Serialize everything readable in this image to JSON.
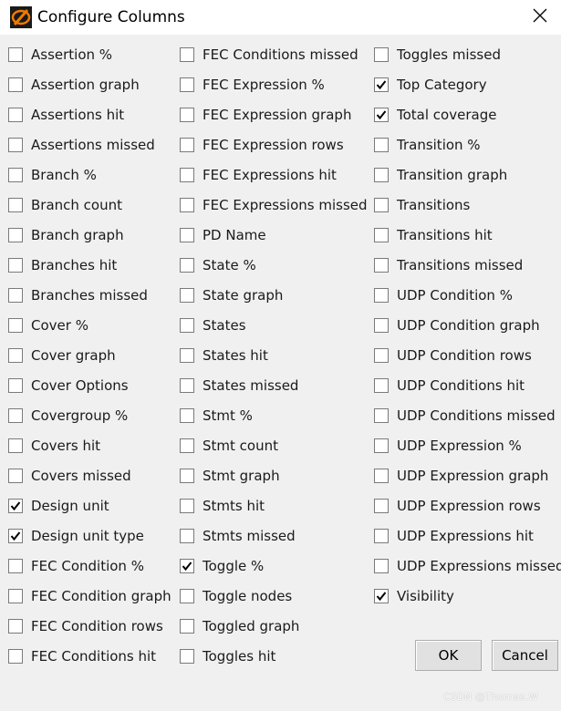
{
  "dialog": {
    "title": "Configure Columns",
    "icon": "app-logo-icon",
    "close_icon": "close-icon"
  },
  "columns": [
    [
      {
        "label": "Assertion %",
        "checked": false
      },
      {
        "label": "Assertion graph",
        "checked": false
      },
      {
        "label": "Assertions hit",
        "checked": false
      },
      {
        "label": "Assertions missed",
        "checked": false
      },
      {
        "label": "Branch %",
        "checked": false
      },
      {
        "label": "Branch count",
        "checked": false
      },
      {
        "label": "Branch graph",
        "checked": false
      },
      {
        "label": "Branches hit",
        "checked": false
      },
      {
        "label": "Branches missed",
        "checked": false
      },
      {
        "label": "Cover %",
        "checked": false
      },
      {
        "label": "Cover graph",
        "checked": false
      },
      {
        "label": "Cover Options",
        "checked": false
      },
      {
        "label": "Covergroup %",
        "checked": false
      },
      {
        "label": "Covers hit",
        "checked": false
      },
      {
        "label": "Covers missed",
        "checked": false
      },
      {
        "label": "Design unit",
        "checked": true
      },
      {
        "label": "Design unit type",
        "checked": true
      },
      {
        "label": "FEC Condition %",
        "checked": false
      },
      {
        "label": "FEC Condition graph",
        "checked": false
      },
      {
        "label": "FEC Condition rows",
        "checked": false
      },
      {
        "label": "FEC Conditions hit",
        "checked": false
      }
    ],
    [
      {
        "label": "FEC Conditions missed",
        "checked": false
      },
      {
        "label": "FEC Expression %",
        "checked": false
      },
      {
        "label": "FEC Expression graph",
        "checked": false
      },
      {
        "label": "FEC Expression rows",
        "checked": false
      },
      {
        "label": "FEC Expressions hit",
        "checked": false
      },
      {
        "label": "FEC Expressions missed",
        "checked": false
      },
      {
        "label": "PD Name",
        "checked": false
      },
      {
        "label": "State %",
        "checked": false
      },
      {
        "label": "State graph",
        "checked": false
      },
      {
        "label": "States",
        "checked": false
      },
      {
        "label": "States hit",
        "checked": false
      },
      {
        "label": "States missed",
        "checked": false
      },
      {
        "label": "Stmt %",
        "checked": false
      },
      {
        "label": "Stmt count",
        "checked": false
      },
      {
        "label": "Stmt graph",
        "checked": false
      },
      {
        "label": "Stmts hit",
        "checked": false
      },
      {
        "label": "Stmts missed",
        "checked": false
      },
      {
        "label": "Toggle %",
        "checked": true
      },
      {
        "label": "Toggle nodes",
        "checked": false
      },
      {
        "label": "Toggled graph",
        "checked": false
      },
      {
        "label": "Toggles hit",
        "checked": false
      }
    ],
    [
      {
        "label": "Toggles missed",
        "checked": false
      },
      {
        "label": "Top Category",
        "checked": true
      },
      {
        "label": "Total coverage",
        "checked": true
      },
      {
        "label": "Transition %",
        "checked": false
      },
      {
        "label": "Transition graph",
        "checked": false
      },
      {
        "label": "Transitions",
        "checked": false
      },
      {
        "label": "Transitions hit",
        "checked": false
      },
      {
        "label": "Transitions missed",
        "checked": false
      },
      {
        "label": "UDP Condition %",
        "checked": false
      },
      {
        "label": "UDP Condition graph",
        "checked": false
      },
      {
        "label": "UDP Condition rows",
        "checked": false
      },
      {
        "label": "UDP Conditions hit",
        "checked": false
      },
      {
        "label": "UDP Conditions missed",
        "checked": false
      },
      {
        "label": "UDP Expression %",
        "checked": false
      },
      {
        "label": "UDP Expression graph",
        "checked": false
      },
      {
        "label": "UDP Expression rows",
        "checked": false
      },
      {
        "label": "UDP Expressions hit",
        "checked": false
      },
      {
        "label": "UDP Expressions missed",
        "checked": false
      },
      {
        "label": "Visibility",
        "checked": true
      }
    ]
  ],
  "buttons": {
    "ok": "OK",
    "cancel": "Cancel"
  },
  "watermark": "CSDN @Thomas.W"
}
